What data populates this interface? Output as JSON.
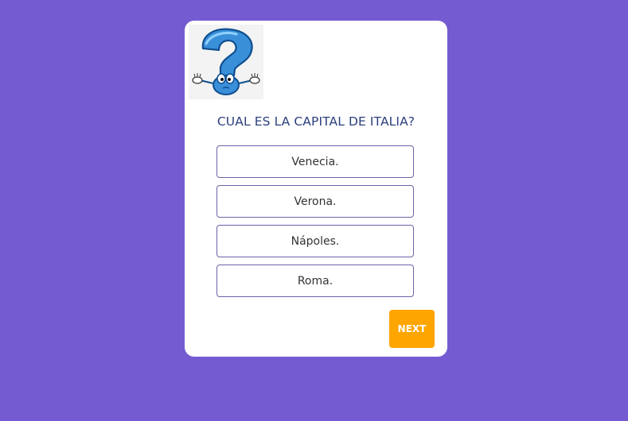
{
  "quiz": {
    "image_icon": "question-mark-character-icon",
    "question": "CUAL ES LA CAPITAL DE ITALIA?",
    "answers": [
      {
        "label": "Venecia."
      },
      {
        "label": "Verona."
      },
      {
        "label": "Nápoles."
      },
      {
        "label": "Roma."
      }
    ],
    "next_label": "NEXT"
  },
  "colors": {
    "background": "#755BD1",
    "card": "#FFFFFF",
    "question_text": "#2C3F7C",
    "answer_border": "#6C63A8",
    "next_button": "#FFA500",
    "icon_blue": "#3A8FD9"
  }
}
